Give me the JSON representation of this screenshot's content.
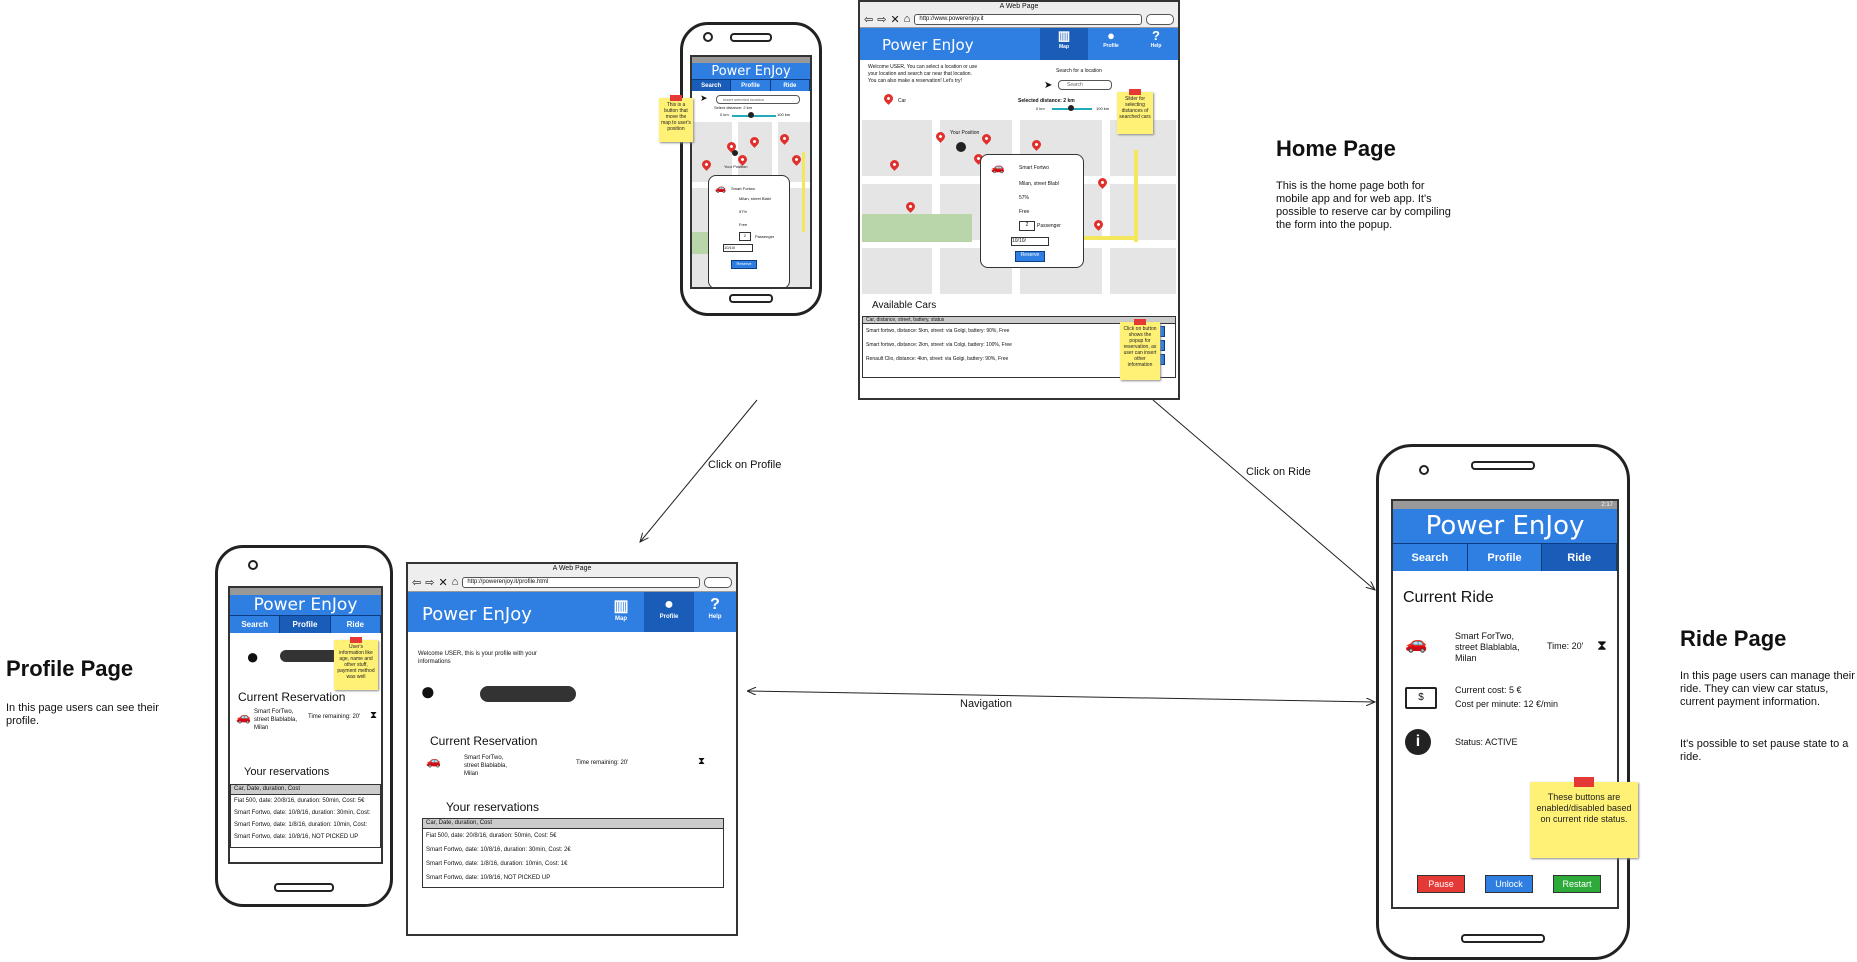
{
  "app_title": "Power EnJoy",
  "tabs": [
    "Search",
    "Profile",
    "Ride"
  ],
  "browser": {
    "window_title": "A Web Page",
    "home_url": "http://www.powerenjoy.it",
    "profile_url": "http://powerenjoy.it/profile.html",
    "nav": [
      "Map",
      "Profile",
      "Help"
    ]
  },
  "home": {
    "heading": "Home Page",
    "desc": "This is the home page both for mobile app and for web app. It's possible to reserve car by compiling the form into the popup.",
    "welcome": "Welcome USER, You can select a location or use your location and search car near that location. You can also make a reservation! Let's try!",
    "search_label": "Search for a location",
    "search_placeholder": "Search",
    "search_placeholder_mobile": "Insert selected location",
    "distance_label": "Selected distance: 2 km",
    "distance_label_mobile": "Select distance: 2 km",
    "range_min": "0 km",
    "range_max": "100 km",
    "car_label": "Car",
    "your_position": "Your Position",
    "popup": {
      "car": "Smart Fortwo",
      "address": "Milan, street Blabl",
      "battery": "57%",
      "status": "Free",
      "passenger_count": "2",
      "passenger_label": "Passenger",
      "date": "10/10/",
      "button": "Reserve"
    },
    "available_cars_title": "Available Cars",
    "available_header": "Car, distance, street, battery, status",
    "available_cars": [
      "Smart fortwo, distance: 5km, street: via Golgi, battery: 90%, Free",
      "Smart fortwo, distance: 2km, street: via Colgi, battery: 100%, Free",
      "Renault Clio, distance: 4km, street: via Golgi, battery: 90%, Free"
    ],
    "reserve_btn": "Reserve",
    "note_map": "This is a button that move the map to user's position",
    "note_slider": "Slider for selecting distances of searched cars",
    "note_button": "Click on button shows the popup for reservation, as user can insert other information"
  },
  "profile": {
    "heading": "Profile Page",
    "desc": "In this page users can see their profile.",
    "welcome": "Welcome USER, this is your profile with your informations",
    "current_title": "Current Reservation",
    "current_car": "Smart ForTwo, street Blablabla, Milan",
    "time_remaining": "Time remaining: 20'",
    "reservations_title": "Your reservations",
    "reservations_header": "Car, Date, duration, Cost",
    "reservations": [
      "Fiat 500, date: 20/8/16, duration: 50min, Cost: 5€",
      "Smart Fortwo, date: 10/8/16, duration: 30min, Cost: 2€",
      "Smart Fortwo, date: 1/8/16, duration: 10min, Cost: 1€",
      "Smart Fortwo, date: 10/8/16, NOT PICKED UP"
    ],
    "reservations_mobile": [
      "Fiat 500, date: 20/8/16, duration: 50min, Cost: 5€",
      "Smart Fortwo, date: 10/8/16, duration: 30min, Cost:",
      "Smart Fortwo, date: 1/8/16, duration: 10min, Cost:",
      "Smart Fortwo, date: 10/8/16, NOT PICKED UP"
    ],
    "note_user": "User's information like age, name and other stuff, payment method was well"
  },
  "ride": {
    "heading": "Ride Page",
    "desc1": "In this page users can manage their ride. They can view car status, current payment information.",
    "desc2": "It's possible to set pause state to a ride.",
    "title": "Current Ride",
    "car": "Smart ForTwo, street Blablabla, Milan",
    "time": "Time: 20'",
    "cost": "Current cost: 5 €",
    "cost_per_minute": "Cost per minute: 12 €/min",
    "status": "Status: ACTIVE",
    "note": "These buttons are enabled/disabled based on current ride status.",
    "buttons": {
      "pause": "Pause",
      "unlock": "Unlock",
      "restart": "Restart"
    },
    "status_time": "2:17"
  },
  "arrows": {
    "profile": "Click on Profile",
    "ride": "Click on Ride",
    "navigation": "Navigation"
  },
  "colors": {
    "primary": "#2f7fe3",
    "primary_dark": "#1a5db8",
    "note": "#fff176",
    "pause": "#e53935",
    "unlock": "#2f7fe3",
    "restart": "#2eaa3a"
  }
}
